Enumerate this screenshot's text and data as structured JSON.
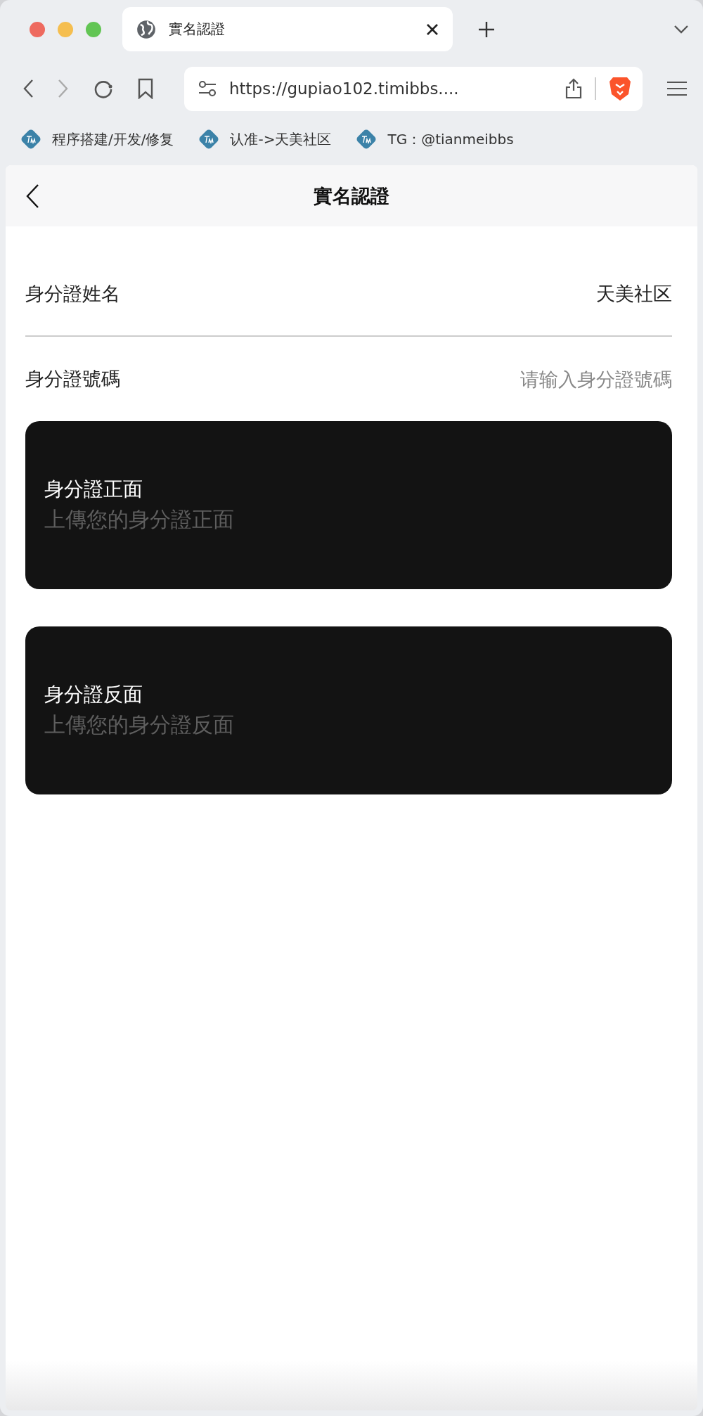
{
  "browser": {
    "tab": {
      "title": "實名認證",
      "selected": true
    },
    "address": "https://gupiao102.timibbs....",
    "bookmarks": [
      {
        "label": "程序搭建/开发/修复"
      },
      {
        "label": "认准->天美社区"
      },
      {
        "label": "TG：@tianmeibbs"
      }
    ]
  },
  "page": {
    "title": "實名認證",
    "fields": [
      {
        "label": "身分證姓名",
        "value": "天美社区"
      },
      {
        "label": "身分證號碼",
        "placeholder": "请输入身分證號碼"
      }
    ],
    "uploads": [
      {
        "title": "身分證正面",
        "hint": "上傳您的身分證正面"
      },
      {
        "title": "身分證反面",
        "hint": "上傳您的身分證反面"
      }
    ]
  }
}
